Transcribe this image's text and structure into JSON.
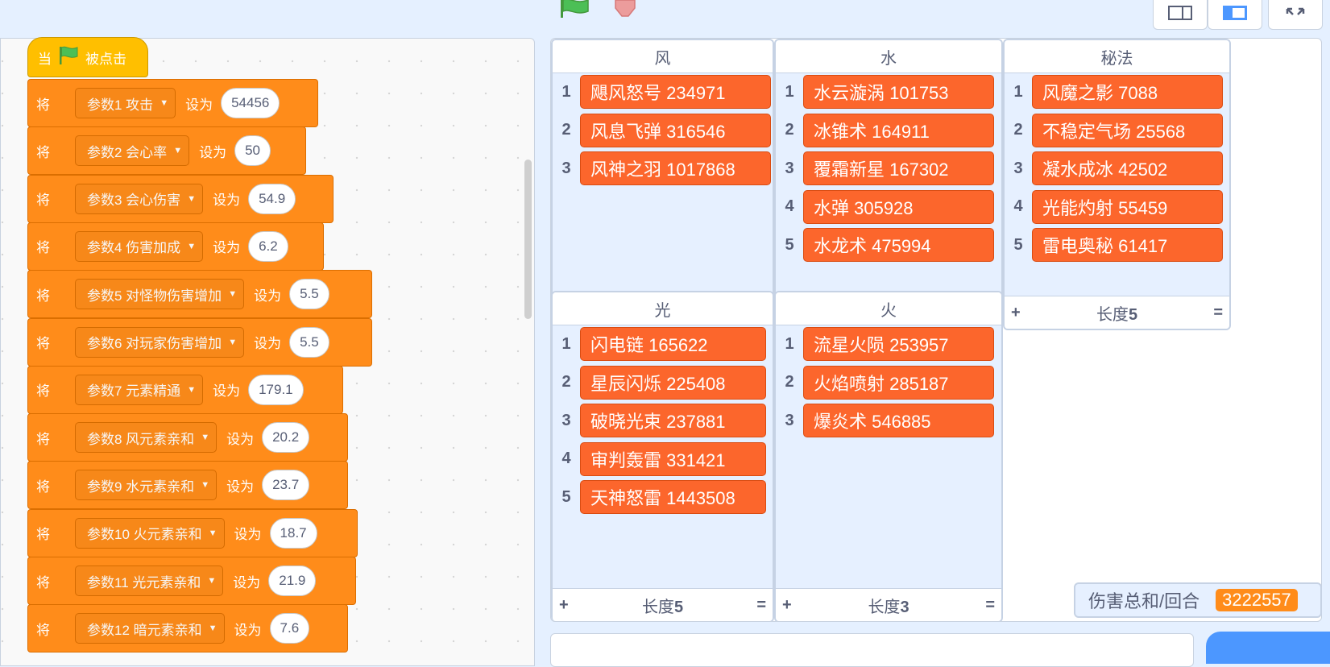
{
  "colors": {
    "hat": "#ffbf00",
    "block": "#ff8c1a",
    "list_item": "#fc662c",
    "accent": "#4c97ff"
  },
  "toolbar": {
    "run_icon": "green-flag-icon",
    "stop_icon": "stop-icon"
  },
  "hat_block": {
    "prefix": "当",
    "suffix": "被点击"
  },
  "blocks": [
    {
      "kw": "将",
      "var": "参数1 攻击",
      "to": "设为",
      "value": "54456"
    },
    {
      "kw": "将",
      "var": "参数2 会心率",
      "to": "设为",
      "value": "50"
    },
    {
      "kw": "将",
      "var": "参数3 会心伤害",
      "to": "设为",
      "value": "54.9"
    },
    {
      "kw": "将",
      "var": "参数4 伤害加成",
      "to": "设为",
      "value": "6.2"
    },
    {
      "kw": "将",
      "var": "参数5 对怪物伤害增加",
      "to": "设为",
      "value": "5.5"
    },
    {
      "kw": "将",
      "var": "参数6 对玩家伤害增加",
      "to": "设为",
      "value": "5.5"
    },
    {
      "kw": "将",
      "var": "参数7 元素精通",
      "to": "设为",
      "value": "179.1"
    },
    {
      "kw": "将",
      "var": "参数8 风元素亲和",
      "to": "设为",
      "value": "20.2"
    },
    {
      "kw": "将",
      "var": "参数9 水元素亲和",
      "to": "设为",
      "value": "23.7"
    },
    {
      "kw": "将",
      "var": "参数10 火元素亲和",
      "to": "设为",
      "value": "18.7"
    },
    {
      "kw": "将",
      "var": "参数11 光元素亲和",
      "to": "设为",
      "value": "21.9"
    },
    {
      "kw": "将",
      "var": "参数12 暗元素亲和",
      "to": "设为",
      "value": "7.6"
    }
  ],
  "lists": [
    {
      "name": "风",
      "items": [
        "飓风怒号 234971",
        "风息飞弹 316546",
        "风神之羽 1017868"
      ],
      "footer": null
    },
    {
      "name": "水",
      "items": [
        "水云漩涡 101753",
        "冰锥术 164911",
        "覆霜新星 167302",
        "水弹 305928",
        "水龙术 475994"
      ],
      "footer": null
    },
    {
      "name": "秘法",
      "items": [
        "风魔之影 7088",
        "不稳定气场 25568",
        "凝水成冰 42502",
        "光能灼射 55459",
        "雷电奥秘 61417"
      ],
      "footer": {
        "plus": "+",
        "label": "长度",
        "len": "5",
        "eq": "="
      }
    },
    {
      "name": "光",
      "items": [
        "闪电链 165622",
        "星辰闪烁 225408",
        "破晓光束 237881",
        "审判轰雷 331421",
        "天神怒雷 1443508"
      ],
      "footer": {
        "plus": "+",
        "label": "长度",
        "len": "5",
        "eq": "="
      }
    },
    {
      "name": "火",
      "items": [
        "流星火陨 253957",
        "火焰喷射 285187",
        "爆炎术 546885"
      ],
      "footer": {
        "plus": "+",
        "label": "长度",
        "len": "3",
        "eq": "="
      }
    }
  ],
  "monitor": {
    "label": "伤害总和/回合",
    "value": "3222557"
  }
}
